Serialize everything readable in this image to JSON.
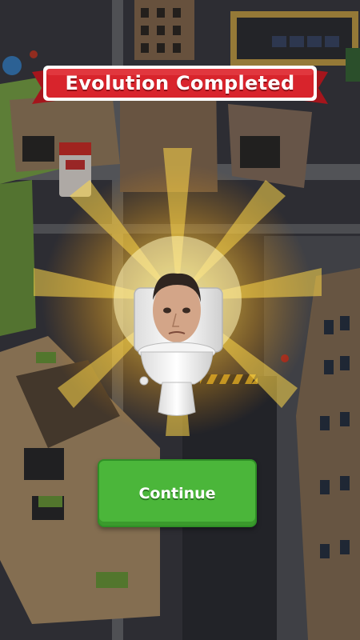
{
  "banner": {
    "title": "Evolution Completed"
  },
  "actions": {
    "continue_label": "Continue"
  },
  "character": {
    "name_icon": "skibidi-toilet-character"
  },
  "colors": {
    "banner_red": "#d8242c",
    "button_green": "#4bb63a",
    "glow": "#ffd34a"
  }
}
